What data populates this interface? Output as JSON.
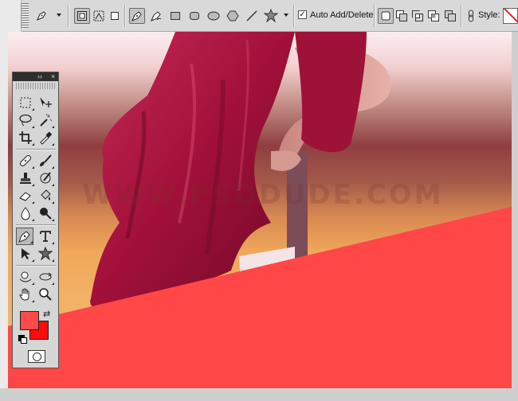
{
  "options_bar": {
    "tool_preset_icon": "pen-icon",
    "modes": [
      "shape-layers-icon",
      "paths-icon",
      "fill-pixels-icon"
    ],
    "tools": [
      "pen-icon",
      "freeform-pen-icon",
      "rectangle-icon",
      "rounded-rectangle-icon",
      "ellipse-icon",
      "polygon-icon",
      "line-icon",
      "custom-shape-icon"
    ],
    "auto_add_delete_checked": true,
    "auto_add_delete_label": "Auto Add/Delete",
    "path_ops": [
      "add-to-shape-area-icon",
      "subtract-icon",
      "intersect-icon",
      "exclude-icon"
    ],
    "link_icon": "link-icon",
    "style_label": "Style:",
    "style_swatch": "no-style"
  },
  "canvas": {
    "watermark": "WWW.PSDDUDE.COM",
    "shape_color": "#ff4747",
    "dress_color": "#b0163f"
  },
  "tools_panel": {
    "title_buttons": [
      "››",
      "×"
    ],
    "foreground_color": "#ff4a4a",
    "background_color": "#ff0b0b"
  }
}
